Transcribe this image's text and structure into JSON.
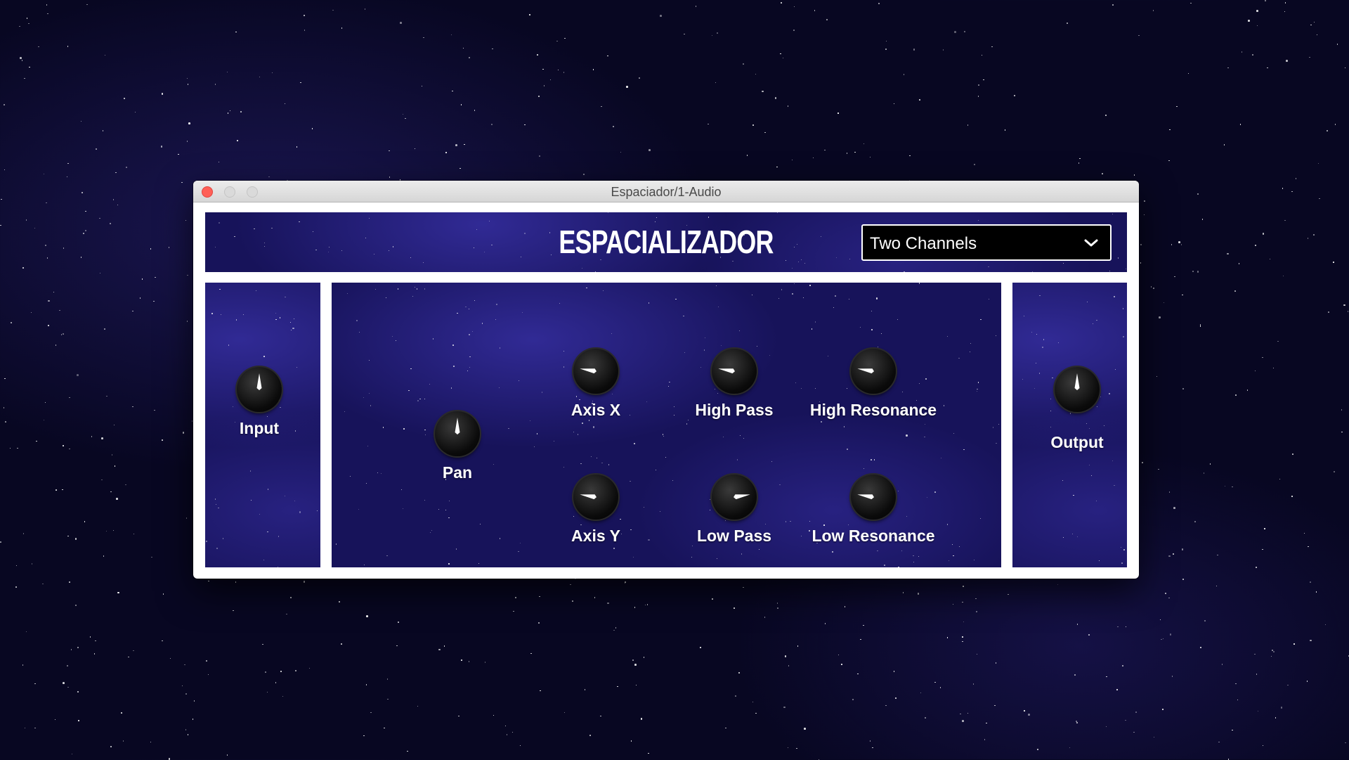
{
  "window": {
    "title": "Espaciador/1-Audio"
  },
  "plugin": {
    "title": "ESPACIALIZADOR"
  },
  "mode_select": {
    "value": "Two Channels"
  },
  "knobs": {
    "input": {
      "label": "Input",
      "value": 0.5
    },
    "pan": {
      "label": "Pan",
      "value": 0.5
    },
    "axis_x": {
      "label": "Axis X",
      "value": 0.2
    },
    "axis_y": {
      "label": "Axis Y",
      "value": 0.2
    },
    "high_pass": {
      "label": "High Pass",
      "value": 0.2
    },
    "low_pass": {
      "label": "Low Pass",
      "value": 0.8
    },
    "high_resonance": {
      "label": "High Resonance",
      "value": 0.2
    },
    "low_resonance": {
      "label": "Low Resonance",
      "value": 0.2
    },
    "output": {
      "label": "Output",
      "value": 0.5
    }
  },
  "colors": {
    "panel": "#17135a",
    "close": "#ff5f57",
    "frame": "#ffffff"
  }
}
